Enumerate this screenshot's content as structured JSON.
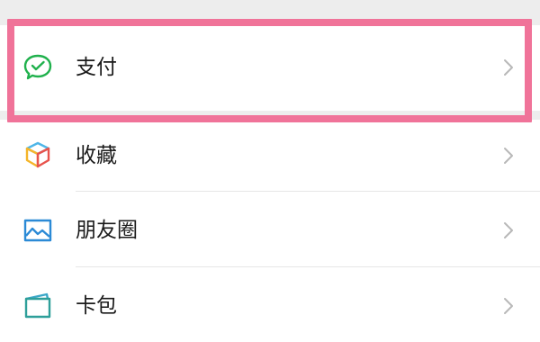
{
  "menu": {
    "items": [
      {
        "label": "支付",
        "icon": "wechat-pay-icon"
      },
      {
        "label": "收藏",
        "icon": "favorites-cube-icon"
      },
      {
        "label": "朋友圈",
        "icon": "moments-image-icon"
      },
      {
        "label": "卡包",
        "icon": "card-wallet-icon"
      }
    ]
  },
  "colors": {
    "highlight": "#f07399",
    "pay_green": "#20b14d",
    "moments_blue": "#2b8ad6",
    "chevron": "#b8b8b8",
    "background": "#ededed"
  }
}
